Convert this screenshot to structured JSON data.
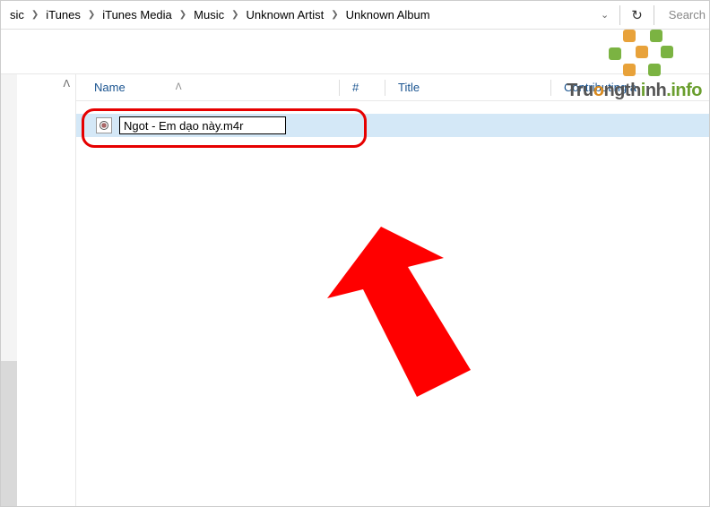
{
  "breadcrumb": {
    "items": [
      "sic",
      "iTunes",
      "iTunes Media",
      "Music",
      "Unknown Artist",
      "Unknown Album"
    ]
  },
  "search": {
    "placeholder": "Search"
  },
  "columns": {
    "name": "Name",
    "num": "#",
    "title": "Title",
    "contributing": "Contributing a"
  },
  "file": {
    "rename_value": "Ngot - Em dạo này.m4r"
  },
  "watermark": {
    "text": "Truongthinh.info"
  }
}
